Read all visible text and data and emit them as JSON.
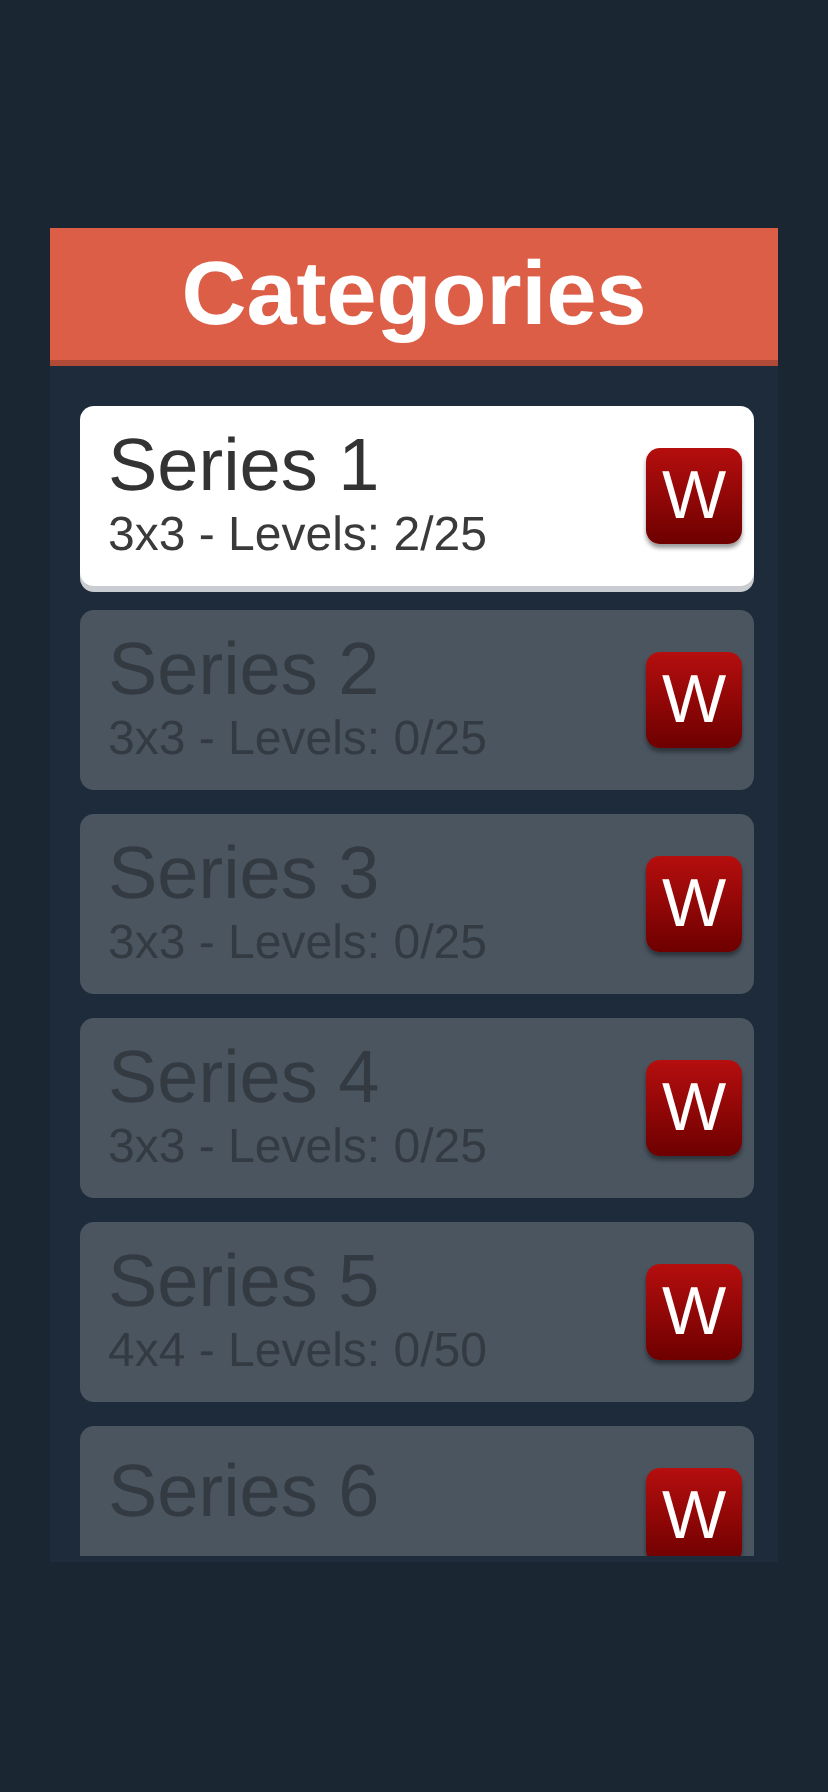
{
  "header": {
    "title": "Categories"
  },
  "series": [
    {
      "name": "Series 1",
      "details": "3x3 - Levels: 2/25",
      "locked": false,
      "badge": "W"
    },
    {
      "name": "Series 2",
      "details": "3x3 - Levels: 0/25",
      "locked": true,
      "badge": "W"
    },
    {
      "name": "Series 3",
      "details": "3x3 - Levels: 0/25",
      "locked": true,
      "badge": "W"
    },
    {
      "name": "Series 4",
      "details": "3x3 - Levels: 0/25",
      "locked": true,
      "badge": "W"
    },
    {
      "name": "Series 5",
      "details": "4x4 - Levels: 0/50",
      "locked": true,
      "badge": "W"
    },
    {
      "name": "Series 6",
      "locked": true,
      "badge": "W"
    }
  ]
}
